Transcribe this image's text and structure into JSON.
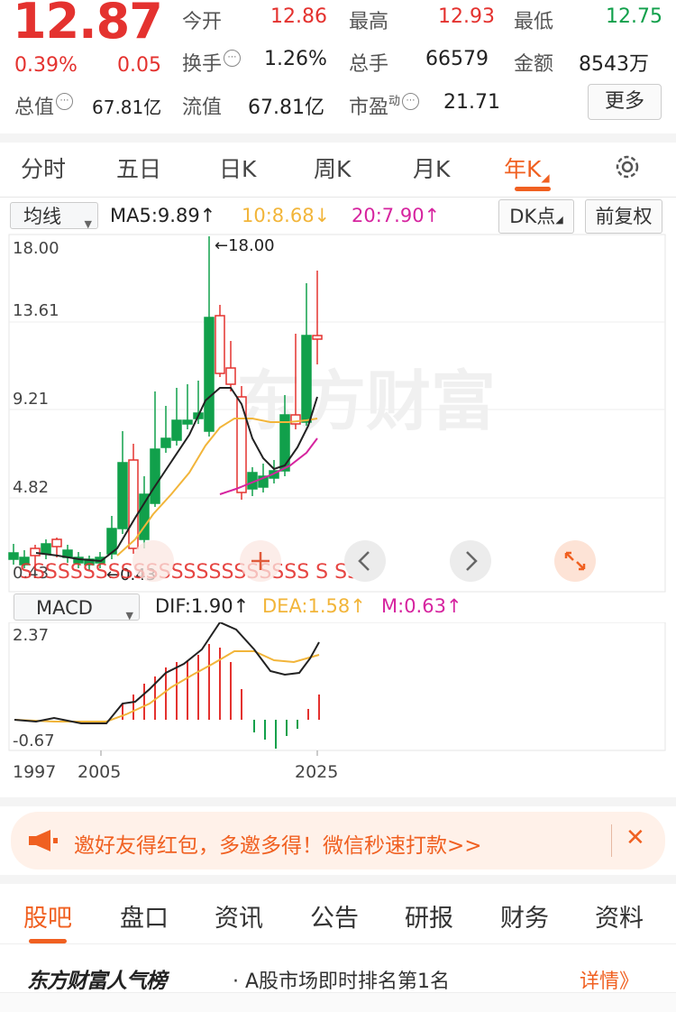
{
  "quote": {
    "price": "12.87",
    "change_pct": "0.39%",
    "change_amt": "0.05",
    "open_label": "今开",
    "open": "12.86",
    "high_label": "最高",
    "high": "12.93",
    "low_label": "最低",
    "low": "12.75",
    "turnover_label": "换手",
    "turnover": "1.26%",
    "volume_label": "总手",
    "volume": "66579",
    "amount_label": "金额",
    "amount": "8543万",
    "mktcap_label": "总值",
    "mktcap": "67.81亿",
    "float_label": "流值",
    "float_cap": "67.81亿",
    "pe_label": "市盈",
    "pe_sup": "动",
    "pe": "21.71",
    "more_label": "更多"
  },
  "period_tabs": [
    "分时",
    "五日",
    "日K",
    "周K",
    "月K",
    "年K"
  ],
  "active_period": "年K",
  "indicator": {
    "select_label": "均线",
    "ma5": "MA5:9.89↑",
    "ma10": "10:8.68↓",
    "ma20": "20:7.90↑",
    "dk_label": "DK点",
    "adjust_label": "前复权"
  },
  "kline": {
    "y_ticks": [
      "18.00",
      "13.61",
      "9.21",
      "4.82",
      "0.43"
    ],
    "max_annotation": "←18.00",
    "min_annotation": "←0.43",
    "watermark": "东方财富",
    "signal_markers": "SSSSSSSSSSSSSSSSSSSSSSS S SS",
    "colors": {
      "up": "#e4322f",
      "down": "#11a04b",
      "ma5": "#222222",
      "ma10": "#f2b53a",
      "ma20": "#d6249f"
    }
  },
  "macd": {
    "select_label": "MACD",
    "dif": "DIF:1.90↑",
    "dea": "DEA:1.58↑",
    "m": "M:0.63↑",
    "y_ticks": [
      "2.37",
      "-0.67"
    ],
    "x_ticks": [
      "1997",
      "2005",
      "2025"
    ]
  },
  "banner": {
    "text": "邀好友得红包，多邀多得！微信秒速打款>>"
  },
  "bottom_tabs": [
    "股吧",
    "盘口",
    "资讯",
    "公告",
    "研报",
    "财务",
    "资料"
  ],
  "active_bottom_tab": "股吧",
  "ranking": {
    "title": "东方财富人气榜",
    "subtitle": "· A股市场即时排名第1名",
    "more": "详情》"
  }
}
